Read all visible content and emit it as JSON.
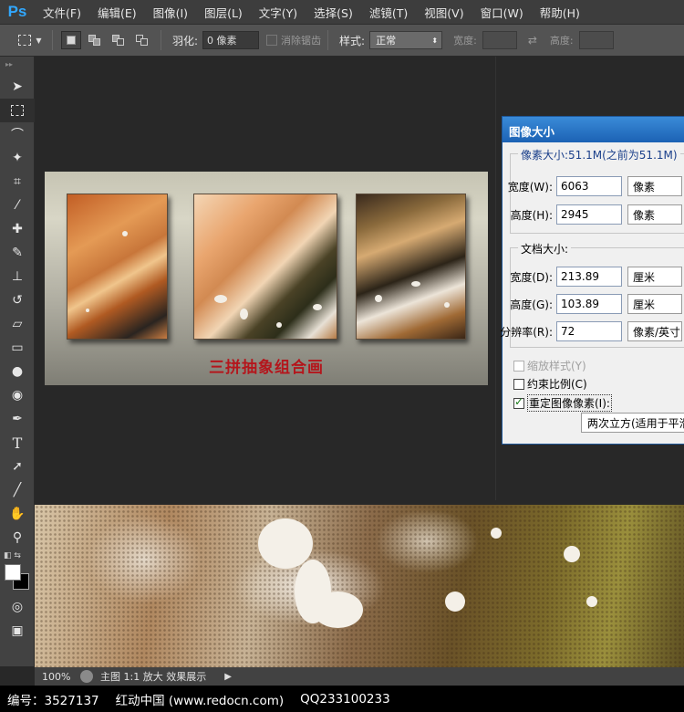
{
  "app": {
    "logo": "Ps"
  },
  "menu": [
    "文件(F)",
    "编辑(E)",
    "图像(I)",
    "图层(L)",
    "文字(Y)",
    "选择(S)",
    "滤镜(T)",
    "视图(V)",
    "窗口(W)",
    "帮助(H)"
  ],
  "options": {
    "feather_label": "羽化:",
    "feather_value": "0 像素",
    "antialias_label": "消除锯齿",
    "style_label": "样式:",
    "style_value": "正常",
    "width_label": "宽度:",
    "height_label": "高度:"
  },
  "preview": {
    "caption": "三拼抽象组合画"
  },
  "dialog": {
    "title": "图像大小",
    "pixel_group": "像素大小:51.1M(之前为51.1M)",
    "pixel_width_label": "宽度(W):",
    "pixel_width_value": "6063",
    "pixel_width_unit": "像素",
    "pixel_height_label": "高度(H):",
    "pixel_height_value": "2945",
    "pixel_height_unit": "像素",
    "doc_group": "文档大小:",
    "doc_width_label": "宽度(D):",
    "doc_width_value": "213.89",
    "doc_width_unit": "厘米",
    "doc_height_label": "高度(G):",
    "doc_height_value": "103.89",
    "doc_height_unit": "厘米",
    "resolution_label": "分辨率(R):",
    "resolution_value": "72",
    "resolution_unit": "像素/英寸",
    "scale_styles": "缩放样式(Y)",
    "constrain": "约束比例(C)",
    "resample": "重定图像像素(I):",
    "resample_method": "两次立方(适用于平滑渐变)"
  },
  "status": {
    "zoom": "100%",
    "text": "主图 1:1 放大     效果展示"
  },
  "footer": {
    "id": "编号：3527137",
    "site": "红动中国 (www.redocn.com)",
    "qq": "QQ233100233"
  }
}
